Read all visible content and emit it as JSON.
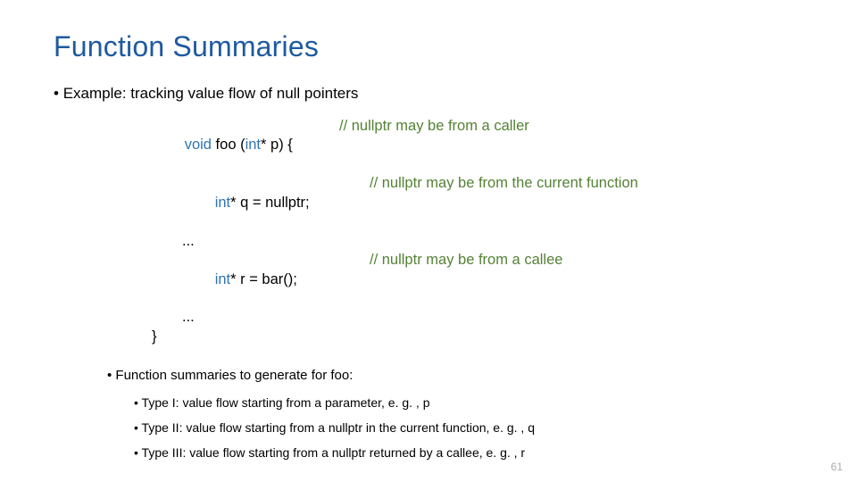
{
  "title": "Function Summaries",
  "example_line": "Example: tracking value flow of null pointers",
  "code": {
    "l1_kw": "void",
    "l1_fn": " foo (",
    "l1_kw2": "int",
    "l1_rest": "* p) {",
    "c1": "// nullptr may be from a caller",
    "l2_kw": "int",
    "l2_rest": "* q = nullptr;",
    "c2": "// nullptr may be from the current function",
    "dots": "...",
    "l3_kw": "int",
    "l3_rest": "* r = bar();",
    "c3": "// nullptr may be from a callee",
    "close": "}"
  },
  "summary_heading": "Function summaries to generate for foo:",
  "type1": "Type I: value flow starting from a parameter, e. g. , p",
  "type2": "Type II: value flow starting from a nullptr in the current function, e. g. , q",
  "type3": "Type III: value flow starting from a nullptr returned by a callee, e. g. , r",
  "page": "61"
}
